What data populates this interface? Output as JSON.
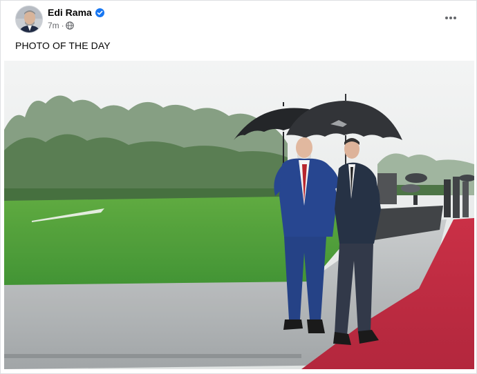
{
  "post": {
    "author": {
      "name": "Edi Rama",
      "verified": true
    },
    "time": "7m",
    "visibility_icon": "globe-icon",
    "options_icon": "more-icon",
    "caption": "PHOTO OF THE DAY",
    "image": {
      "description_icon": "photo",
      "subject": "Two men walking on a red carpet under black umbrellas beside a green lawn in the rain"
    }
  },
  "colors": {
    "verified_badge": "#1877f2",
    "meta_text": "#65676b",
    "name_text": "#050505",
    "carpet": "#b8243a",
    "lawn": "#3f9a2f"
  }
}
